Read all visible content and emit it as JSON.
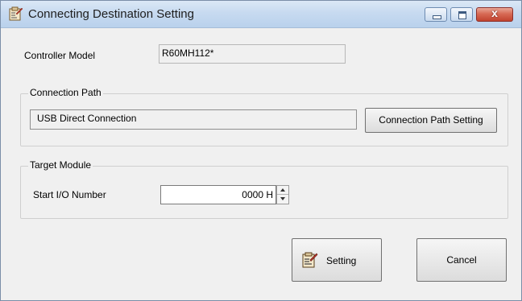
{
  "window": {
    "title": "Connecting Destination Setting",
    "controls": {
      "minimize": "minimize",
      "maximize": "maximize",
      "close": "x"
    }
  },
  "controller_model": {
    "label": "Controller Model",
    "value": "R60MH112*"
  },
  "connection_path": {
    "group_label": "Connection Path",
    "value": "USB Direct Connection",
    "setting_button": "Connection Path Setting"
  },
  "target_module": {
    "group_label": "Target Module",
    "start_io_label": "Start I/O Number",
    "start_io_value": "0000 H"
  },
  "buttons": {
    "setting": "Setting",
    "cancel": "Cancel"
  },
  "icons": {
    "app": "settings-clipboard-icon",
    "setting": "settings-clipboard-icon"
  },
  "colors": {
    "titlebar": "#c7daf0",
    "close_button": "#c1432f",
    "window_bg": "#f0f0f0"
  }
}
